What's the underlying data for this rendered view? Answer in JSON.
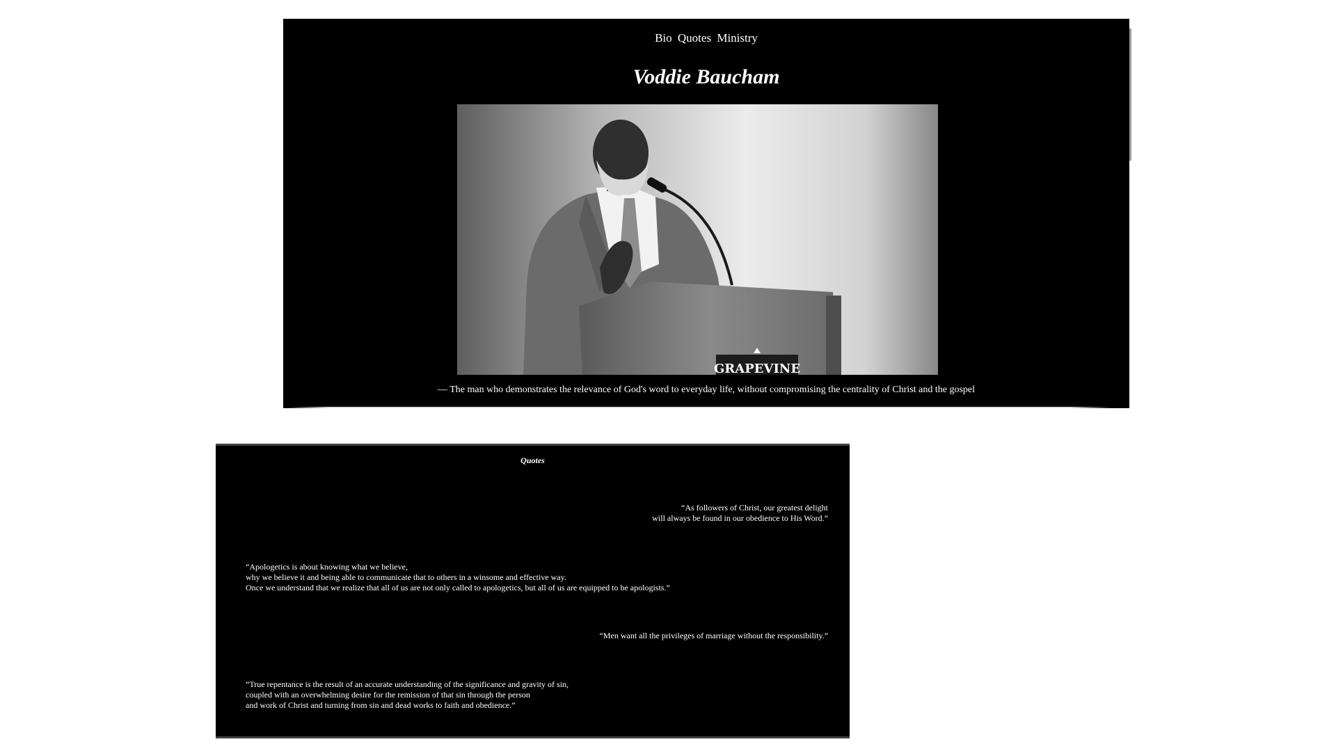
{
  "nav": {
    "bio": "Bio",
    "quotes": "Quotes",
    "ministry": "Ministry"
  },
  "hero": {
    "title": "Voddie Baucham",
    "image_alt": "Black and white photo of a man speaking at a podium",
    "podium_sign": "GRAPEVINE",
    "caption": "— The man who demonstrates the relevance of God's word to everyday life, without compromising the centrality of Christ and the gospel"
  },
  "quotes_section": {
    "heading": "Quotes",
    "items": [
      {
        "text": "“As followers of Christ, our greatest delight\nwill always be found in our obedience to His Word.”",
        "align": "right"
      },
      {
        "text": "“Apologetics is about knowing what we believe,\nwhy we believe it and being able to communicate that to others in a winsome and effective way.\nOnce we understand that we realize that all of us are not only called to apologetics, but all of us are equipped to be apologists.”",
        "align": "left"
      },
      {
        "text": "“Men want all the privileges of marriage without the responsibility.”",
        "align": "right"
      },
      {
        "text": "“True repentance is the result of an accurate understanding of the significance and gravity of sin,\ncoupled with an overwhelming desire for the remission of that sin through the person\nand work of Christ and turning from sin and dead works to faith and obedience.”",
        "align": "left"
      }
    ]
  },
  "colors": {
    "panel_background": "#000000",
    "text": "#ffffff",
    "page_background": "#ffffff"
  }
}
